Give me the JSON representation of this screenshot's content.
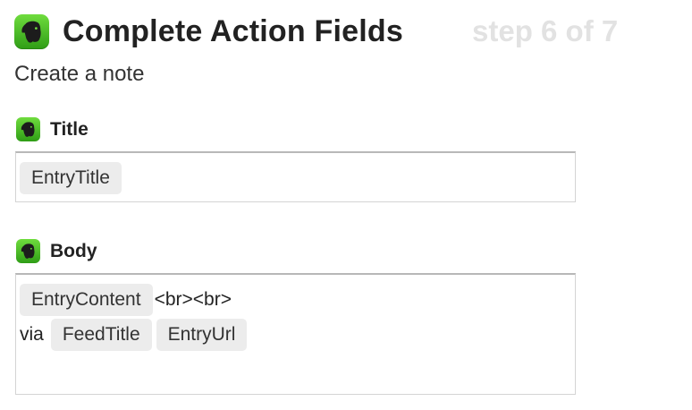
{
  "header": {
    "app_icon": "evernote-icon",
    "title": "Complete Action Fields",
    "step": "step 6 of 7"
  },
  "subtitle": "Create a note",
  "colors": {
    "icon_green_top": "#6fdc3e",
    "icon_green_bottom": "#2f9d16",
    "step_text": "#e2e2e2",
    "pill_background": "#ececec"
  },
  "fields": {
    "title": {
      "label": "Title",
      "icon": "evernote-icon",
      "tokens": [
        "EntryTitle"
      ]
    },
    "body": {
      "label": "Body",
      "icon": "evernote-icon",
      "line1": {
        "token": "EntryContent",
        "text": "<br><br>"
      },
      "line2": {
        "text": "via",
        "tokens": [
          "FeedTitle",
          "EntryUrl"
        ]
      }
    }
  }
}
